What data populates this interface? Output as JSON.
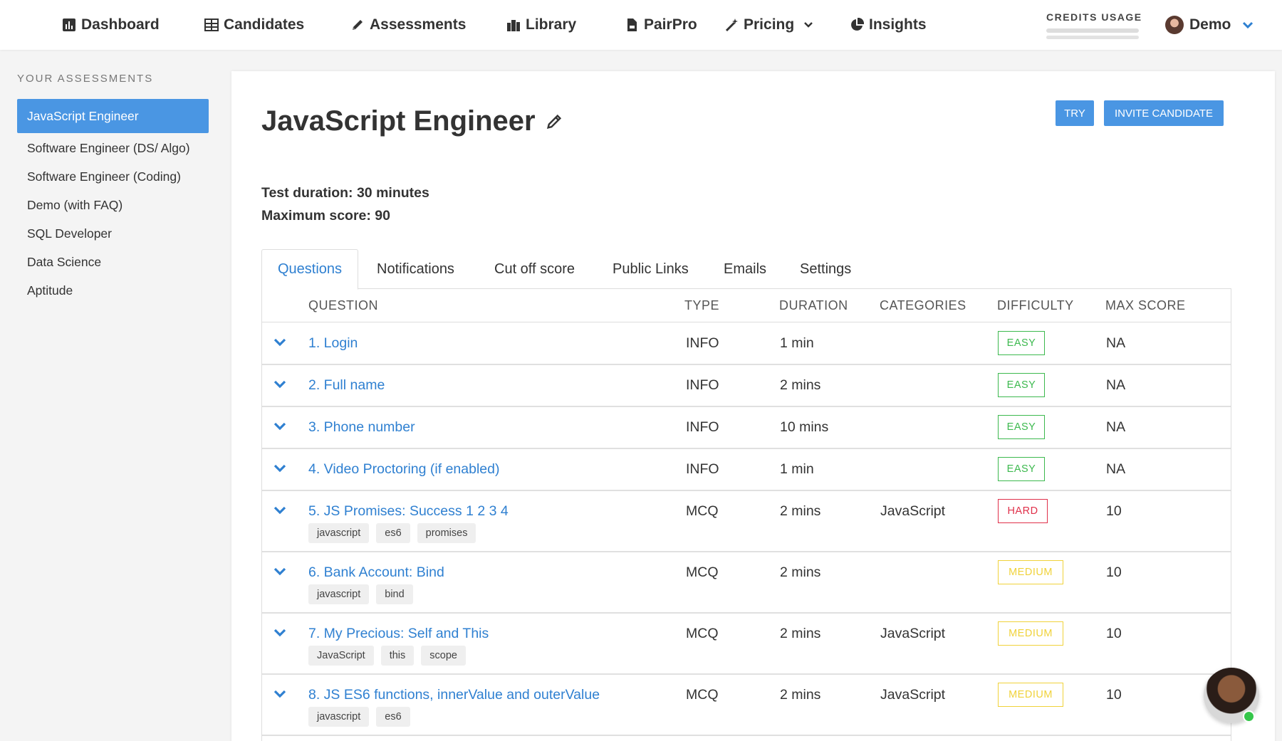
{
  "nav": {
    "items": [
      {
        "label": "Dashboard",
        "icon": "chart-icon"
      },
      {
        "label": "Candidates",
        "icon": "table-icon"
      },
      {
        "label": "Assessments",
        "icon": "pencil-icon"
      },
      {
        "label": "Library",
        "icon": "library-icon"
      },
      {
        "label": "PairPro",
        "icon": "document-icon"
      },
      {
        "label": "Pricing",
        "icon": "magic-wand-icon"
      },
      {
        "label": "Insights",
        "icon": "pie-chart-icon"
      }
    ],
    "credits_label": "CREDITS USAGE",
    "user_name": "Demo"
  },
  "sidebar": {
    "heading": "YOUR ASSESSMENTS",
    "items": [
      {
        "label": "JavaScript Engineer"
      },
      {
        "label": "Software Engineer (DS/ Algo)"
      },
      {
        "label": "Software Engineer (Coding)"
      },
      {
        "label": "Demo (with FAQ)"
      },
      {
        "label": "SQL Developer"
      },
      {
        "label": "Data Science"
      },
      {
        "label": "Aptitude"
      }
    ]
  },
  "main": {
    "title": "JavaScript Engineer",
    "try_label": "TRY",
    "invite_label": "INVITE CANDIDATE",
    "duration_text": "Test duration: 30 minutes",
    "max_score_text": "Maximum score: 90",
    "tabs": [
      {
        "label": "Questions"
      },
      {
        "label": "Notifications"
      },
      {
        "label": "Cut off score"
      },
      {
        "label": "Public Links"
      },
      {
        "label": "Emails"
      },
      {
        "label": "Settings"
      }
    ],
    "columns": {
      "question": "QUESTION",
      "type": "TYPE",
      "duration": "DURATION",
      "categories": "CATEGORIES",
      "difficulty": "DIFFICULTY",
      "max_score": "MAX SCORE"
    },
    "questions": [
      {
        "title": "1. Login",
        "type": "INFO",
        "duration": "1 min",
        "category": "",
        "difficulty": "EASY",
        "max_score": "NA",
        "tags": []
      },
      {
        "title": "2. Full name",
        "type": "INFO",
        "duration": "2 mins",
        "category": "",
        "difficulty": "EASY",
        "max_score": "NA",
        "tags": []
      },
      {
        "title": "3. Phone number",
        "type": "INFO",
        "duration": "10 mins",
        "category": "",
        "difficulty": "EASY",
        "max_score": "NA",
        "tags": []
      },
      {
        "title": "4. Video Proctoring (if enabled)",
        "type": "INFO",
        "duration": "1 min",
        "category": "",
        "difficulty": "EASY",
        "max_score": "NA",
        "tags": []
      },
      {
        "title": "5. JS Promises: Success 1 2 3 4",
        "type": "MCQ",
        "duration": "2 mins",
        "category": "JavaScript",
        "difficulty": "HARD",
        "max_score": "10",
        "tags": [
          "javascript",
          "es6",
          "promises"
        ]
      },
      {
        "title": "6. Bank Account: Bind",
        "type": "MCQ",
        "duration": "2 mins",
        "category": "",
        "difficulty": "MEDIUM",
        "max_score": "10",
        "tags": [
          "javascript",
          "bind"
        ]
      },
      {
        "title": "7. My Precious: Self and This",
        "type": "MCQ",
        "duration": "2 mins",
        "category": "JavaScript",
        "difficulty": "MEDIUM",
        "max_score": "10",
        "tags": [
          "JavaScript",
          "this",
          "scope"
        ]
      },
      {
        "title": "8. JS ES6 functions, innerValue and outerValue",
        "type": "MCQ",
        "duration": "2 mins",
        "category": "JavaScript",
        "difficulty": "MEDIUM",
        "max_score": "10",
        "tags": [
          "javascript",
          "es6"
        ]
      }
    ]
  },
  "colors": {
    "accent": "#4a96e3",
    "link": "#2f80d1",
    "easy": "#3cb94e",
    "hard": "#e0304a",
    "medium": "#f0d23a",
    "online": "#35c64a"
  }
}
